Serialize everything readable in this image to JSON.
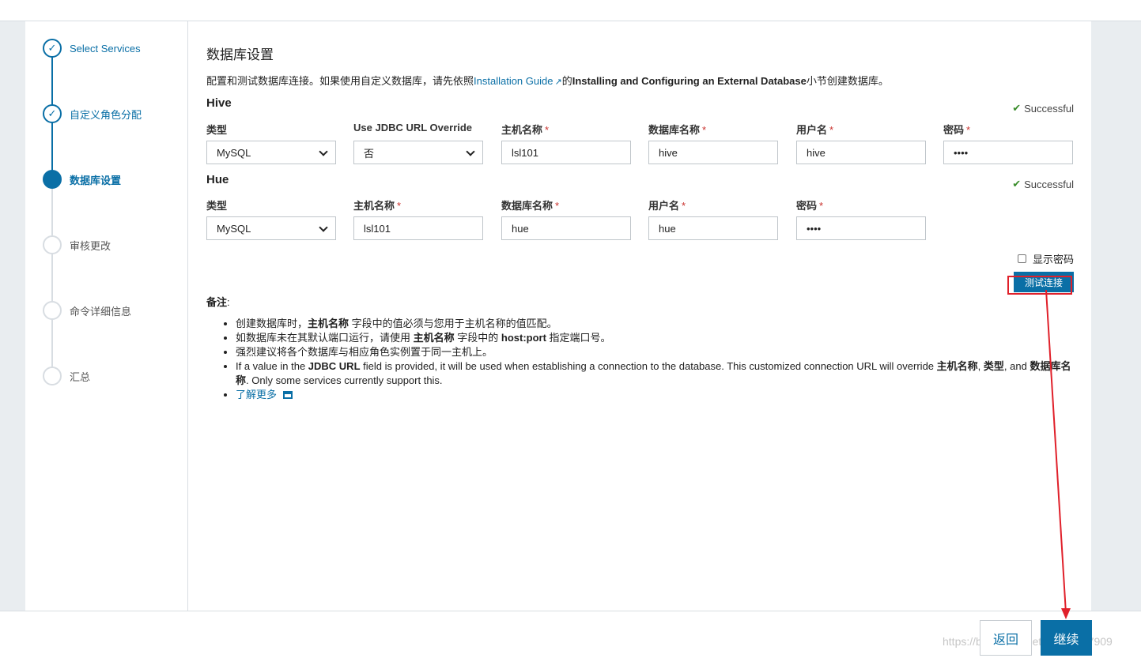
{
  "wizard": {
    "steps": [
      {
        "label": "Select Services",
        "state": "done"
      },
      {
        "label": "自定义角色分配",
        "state": "done"
      },
      {
        "label": "数据库设置",
        "state": "current"
      },
      {
        "label": "审核更改",
        "state": "pending"
      },
      {
        "label": "命令详细信息",
        "state": "pending"
      },
      {
        "label": "汇总",
        "state": "pending"
      }
    ],
    "check_glyph": "✓"
  },
  "page": {
    "title": "数据库设置",
    "intro_prefix": "配置和测试数据库连接。如果使用自定义数据库，请先依照",
    "intro_link": "Installation Guide",
    "intro_mid": "的",
    "intro_bold": "Installing and Configuring an External Database",
    "intro_suffix": "小节创建数据库。"
  },
  "hive": {
    "title": "Hive",
    "status": "Successful",
    "fields": {
      "type": {
        "label": "类型",
        "value": "MySQL"
      },
      "jdbc_override": {
        "label": "Use JDBC URL Override",
        "value": "否"
      },
      "host": {
        "label": "主机名称",
        "value": "lsl101"
      },
      "db_name": {
        "label": "数据库名称",
        "value": "hive"
      },
      "username": {
        "label": "用户名",
        "value": "hive"
      },
      "password": {
        "label": "密码",
        "value": "••••"
      }
    }
  },
  "hue": {
    "title": "Hue",
    "status": "Successful",
    "fields": {
      "type": {
        "label": "类型",
        "value": "MySQL"
      },
      "host": {
        "label": "主机名称",
        "value": "lsl101"
      },
      "db_name": {
        "label": "数据库名称",
        "value": "hue"
      },
      "username": {
        "label": "用户名",
        "value": "hue"
      },
      "password": {
        "label": "密码",
        "value": "••••"
      }
    }
  },
  "required_mark": "*",
  "status_glyph": "✔",
  "show_password_label": "显示密码",
  "test_button_label": "测试连接",
  "notes": {
    "title": "备注",
    "title_colon": ":",
    "items": {
      "n1_a": "创建数据库时，",
      "n1_b": "主机名称",
      "n1_c": " 字段中的值必须与您用于主机名称的值匹配。",
      "n2_a": "如数据库未在其默认端口运行，请使用 ",
      "n2_b": "主机名称",
      "n2_c": " 字段中的 ",
      "n2_d": "host:port",
      "n2_e": " 指定端口号。",
      "n3": "强烈建议将各个数据库与相应角色实例置于同一主机上。",
      "n4_a": "If a value in the ",
      "n4_b": "JDBC URL",
      "n4_c": " field is provided, it will be used when establishing a connection to the database. This customized connection URL will override ",
      "n4_d": "主机名称",
      "n4_e": ", ",
      "n4_f": "类型",
      "n4_g": ", and ",
      "n4_h": "数据库名称",
      "n4_i": ". Only some services currently support this.",
      "learn_more": "了解更多"
    }
  },
  "footer": {
    "back_label": "返回",
    "continue_label": "继续",
    "watermark": "https://blog.csdn.net/qq_39657909"
  },
  "colors": {
    "accent": "#0a6fa6",
    "success": "#3a8d2b",
    "annotation": "#e0202a"
  }
}
